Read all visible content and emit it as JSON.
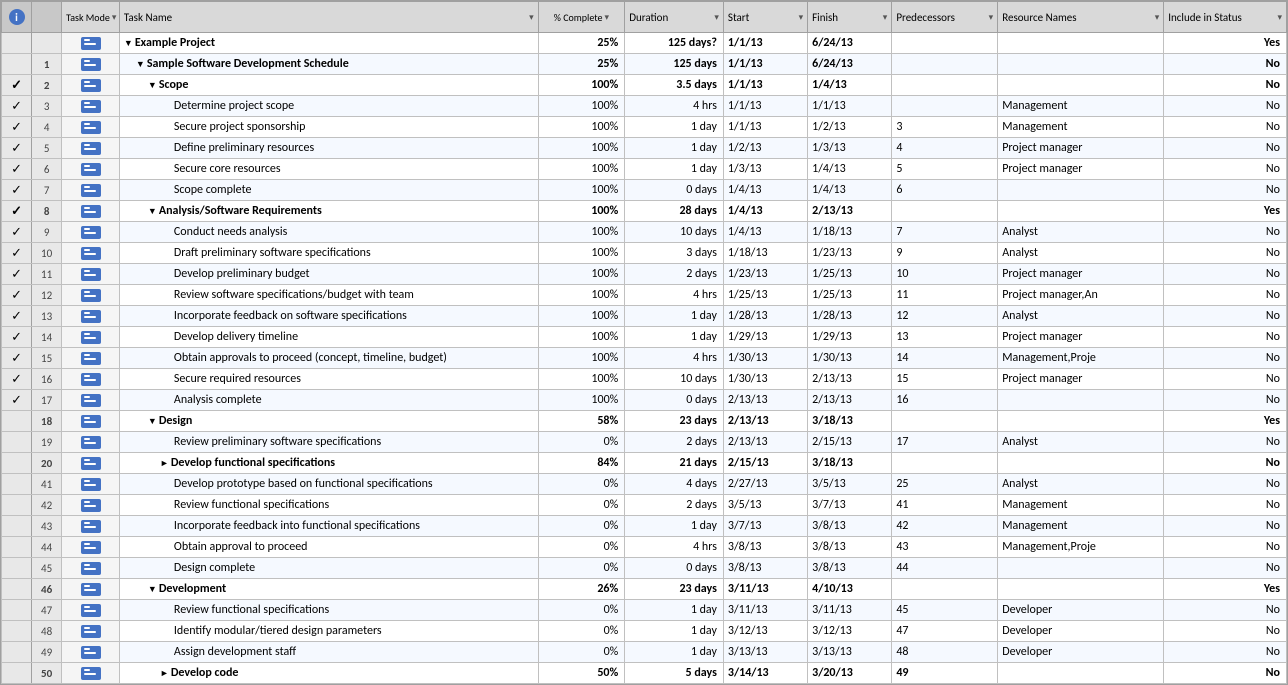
{
  "header": {
    "col_info": "i",
    "col_mode": "Task\nMode",
    "col_name": "Task Name",
    "col_pct": "% Complete",
    "col_duration": "Duration",
    "col_start": "Start",
    "col_finish": "Finish",
    "col_pred": "Predecessors",
    "col_resource": "Resource Names",
    "col_status": "Include in Status"
  },
  "rows": [
    {
      "row": "",
      "check": false,
      "mode": "auto",
      "indent": 0,
      "collapse": "collapse",
      "bold": true,
      "name": "Example Project",
      "pct": "25%",
      "duration": "125 days?",
      "start": "1/1/13",
      "finish": "6/24/13",
      "pred": "",
      "resource": "",
      "status": "Yes"
    },
    {
      "row": "1",
      "check": false,
      "mode": "auto",
      "indent": 1,
      "collapse": "collapse",
      "bold": true,
      "name": "Sample Software Development Schedule",
      "pct": "25%",
      "duration": "125 days",
      "start": "1/1/13",
      "finish": "6/24/13",
      "pred": "",
      "resource": "",
      "status": "No"
    },
    {
      "row": "2",
      "check": true,
      "mode": "auto",
      "indent": 2,
      "collapse": "collapse",
      "bold": true,
      "name": "Scope",
      "pct": "100%",
      "duration": "3.5 days",
      "start": "1/1/13",
      "finish": "1/4/13",
      "pred": "",
      "resource": "",
      "status": "No"
    },
    {
      "row": "3",
      "check": true,
      "mode": "auto",
      "indent": 3,
      "collapse": null,
      "bold": false,
      "name": "Determine project scope",
      "pct": "100%",
      "duration": "4 hrs",
      "start": "1/1/13",
      "finish": "1/1/13",
      "pred": "",
      "resource": "Management",
      "status": "No"
    },
    {
      "row": "4",
      "check": true,
      "mode": "auto",
      "indent": 3,
      "collapse": null,
      "bold": false,
      "name": "Secure project sponsorship",
      "pct": "100%",
      "duration": "1 day",
      "start": "1/1/13",
      "finish": "1/2/13",
      "pred": "3",
      "resource": "Management",
      "status": "No"
    },
    {
      "row": "5",
      "check": true,
      "mode": "auto",
      "indent": 3,
      "collapse": null,
      "bold": false,
      "name": "Define preliminary resources",
      "pct": "100%",
      "duration": "1 day",
      "start": "1/2/13",
      "finish": "1/3/13",
      "pred": "4",
      "resource": "Project manager",
      "status": "No"
    },
    {
      "row": "6",
      "check": true,
      "mode": "auto",
      "indent": 3,
      "collapse": null,
      "bold": false,
      "name": "Secure core resources",
      "pct": "100%",
      "duration": "1 day",
      "start": "1/3/13",
      "finish": "1/4/13",
      "pred": "5",
      "resource": "Project manager",
      "status": "No"
    },
    {
      "row": "7",
      "check": true,
      "mode": "auto",
      "indent": 3,
      "collapse": null,
      "bold": false,
      "name": "Scope complete",
      "pct": "100%",
      "duration": "0 days",
      "start": "1/4/13",
      "finish": "1/4/13",
      "pred": "6",
      "resource": "",
      "status": "No"
    },
    {
      "row": "8",
      "check": true,
      "mode": "auto",
      "indent": 2,
      "collapse": "collapse",
      "bold": true,
      "name": "Analysis/Software Requirements",
      "pct": "100%",
      "duration": "28 days",
      "start": "1/4/13",
      "finish": "2/13/13",
      "pred": "",
      "resource": "",
      "status": "Yes"
    },
    {
      "row": "9",
      "check": true,
      "mode": "auto",
      "indent": 3,
      "collapse": null,
      "bold": false,
      "name": "Conduct needs analysis",
      "pct": "100%",
      "duration": "10 days",
      "start": "1/4/13",
      "finish": "1/18/13",
      "pred": "7",
      "resource": "Analyst",
      "status": "No"
    },
    {
      "row": "10",
      "check": true,
      "mode": "auto",
      "indent": 3,
      "collapse": null,
      "bold": false,
      "name": "Draft preliminary software specifications",
      "pct": "100%",
      "duration": "3 days",
      "start": "1/18/13",
      "finish": "1/23/13",
      "pred": "9",
      "resource": "Analyst",
      "status": "No"
    },
    {
      "row": "11",
      "check": true,
      "mode": "auto",
      "indent": 3,
      "collapse": null,
      "bold": false,
      "name": "Develop preliminary budget",
      "pct": "100%",
      "duration": "2 days",
      "start": "1/23/13",
      "finish": "1/25/13",
      "pred": "10",
      "resource": "Project manager",
      "status": "No"
    },
    {
      "row": "12",
      "check": true,
      "mode": "auto",
      "indent": 3,
      "collapse": null,
      "bold": false,
      "name": "Review software specifications/budget with team",
      "pct": "100%",
      "duration": "4 hrs",
      "start": "1/25/13",
      "finish": "1/25/13",
      "pred": "11",
      "resource": "Project manager,An",
      "status": "No"
    },
    {
      "row": "13",
      "check": true,
      "mode": "auto",
      "indent": 3,
      "collapse": null,
      "bold": false,
      "name": "Incorporate feedback on software specifications",
      "pct": "100%",
      "duration": "1 day",
      "start": "1/28/13",
      "finish": "1/28/13",
      "pred": "12",
      "resource": "Analyst",
      "status": "No"
    },
    {
      "row": "14",
      "check": true,
      "mode": "auto",
      "indent": 3,
      "collapse": null,
      "bold": false,
      "name": "Develop delivery timeline",
      "pct": "100%",
      "duration": "1 day",
      "start": "1/29/13",
      "finish": "1/29/13",
      "pred": "13",
      "resource": "Project manager",
      "status": "No"
    },
    {
      "row": "15",
      "check": true,
      "mode": "auto",
      "indent": 3,
      "collapse": null,
      "bold": false,
      "name": "Obtain approvals to proceed (concept, timeline, budget)",
      "pct": "100%",
      "duration": "4 hrs",
      "start": "1/30/13",
      "finish": "1/30/13",
      "pred": "14",
      "resource": "Management,Proje",
      "status": "No"
    },
    {
      "row": "16",
      "check": true,
      "mode": "auto",
      "indent": 3,
      "collapse": null,
      "bold": false,
      "name": "Secure required resources",
      "pct": "100%",
      "duration": "10 days",
      "start": "1/30/13",
      "finish": "2/13/13",
      "pred": "15",
      "resource": "Project manager",
      "status": "No"
    },
    {
      "row": "17",
      "check": true,
      "mode": "auto",
      "indent": 3,
      "collapse": null,
      "bold": false,
      "name": "Analysis complete",
      "pct": "100%",
      "duration": "0 days",
      "start": "2/13/13",
      "finish": "2/13/13",
      "pred": "16",
      "resource": "",
      "status": "No"
    },
    {
      "row": "18",
      "check": false,
      "mode": "auto",
      "indent": 2,
      "collapse": "collapse",
      "bold": true,
      "name": "Design",
      "pct": "58%",
      "duration": "23 days",
      "start": "2/13/13",
      "finish": "3/18/13",
      "pred": "",
      "resource": "",
      "status": "Yes"
    },
    {
      "row": "19",
      "check": false,
      "mode": "auto",
      "indent": 3,
      "collapse": null,
      "bold": false,
      "name": "Review preliminary software specifications",
      "pct": "0%",
      "duration": "2 days",
      "start": "2/13/13",
      "finish": "2/15/13",
      "pred": "17",
      "resource": "Analyst",
      "status": "No"
    },
    {
      "row": "20",
      "check": false,
      "mode": "auto",
      "indent": 3,
      "collapse": "expand",
      "bold": true,
      "name": "Develop functional specifications",
      "pct": "84%",
      "duration": "21 days",
      "start": "2/15/13",
      "finish": "3/18/13",
      "pred": "",
      "resource": "",
      "status": "No"
    },
    {
      "row": "41",
      "check": false,
      "mode": "auto",
      "indent": 3,
      "collapse": null,
      "bold": false,
      "name": "Develop prototype based on functional specifications",
      "pct": "0%",
      "duration": "4 days",
      "start": "2/27/13",
      "finish": "3/5/13",
      "pred": "25",
      "resource": "Analyst",
      "status": "No"
    },
    {
      "row": "42",
      "check": false,
      "mode": "auto",
      "indent": 3,
      "collapse": null,
      "bold": false,
      "name": "Review functional specifications",
      "pct": "0%",
      "duration": "2 days",
      "start": "3/5/13",
      "finish": "3/7/13",
      "pred": "41",
      "resource": "Management",
      "status": "No"
    },
    {
      "row": "43",
      "check": false,
      "mode": "auto",
      "indent": 3,
      "collapse": null,
      "bold": false,
      "name": "Incorporate feedback into functional specifications",
      "pct": "0%",
      "duration": "1 day",
      "start": "3/7/13",
      "finish": "3/8/13",
      "pred": "42",
      "resource": "Management",
      "status": "No"
    },
    {
      "row": "44",
      "check": false,
      "mode": "auto",
      "indent": 3,
      "collapse": null,
      "bold": false,
      "name": "Obtain approval to proceed",
      "pct": "0%",
      "duration": "4 hrs",
      "start": "3/8/13",
      "finish": "3/8/13",
      "pred": "43",
      "resource": "Management,Proje",
      "status": "No"
    },
    {
      "row": "45",
      "check": false,
      "mode": "auto",
      "indent": 3,
      "collapse": null,
      "bold": false,
      "name": "Design complete",
      "pct": "0%",
      "duration": "0 days",
      "start": "3/8/13",
      "finish": "3/8/13",
      "pred": "44",
      "resource": "",
      "status": "No"
    },
    {
      "row": "46",
      "check": false,
      "mode": "auto",
      "indent": 2,
      "collapse": "collapse",
      "bold": true,
      "name": "Development",
      "pct": "26%",
      "duration": "23 days",
      "start": "3/11/13",
      "finish": "4/10/13",
      "pred": "",
      "resource": "",
      "status": "Yes"
    },
    {
      "row": "47",
      "check": false,
      "mode": "auto",
      "indent": 3,
      "collapse": null,
      "bold": false,
      "name": "Review functional specifications",
      "pct": "0%",
      "duration": "1 day",
      "start": "3/11/13",
      "finish": "3/11/13",
      "pred": "45",
      "resource": "Developer",
      "status": "No"
    },
    {
      "row": "48",
      "check": false,
      "mode": "auto",
      "indent": 3,
      "collapse": null,
      "bold": false,
      "name": "Identify modular/tiered design parameters",
      "pct": "0%",
      "duration": "1 day",
      "start": "3/12/13",
      "finish": "3/12/13",
      "pred": "47",
      "resource": "Developer",
      "status": "No"
    },
    {
      "row": "49",
      "check": false,
      "mode": "auto",
      "indent": 3,
      "collapse": null,
      "bold": false,
      "name": "Assign development staff",
      "pct": "0%",
      "duration": "1 day",
      "start": "3/13/13",
      "finish": "3/13/13",
      "pred": "48",
      "resource": "Developer",
      "status": "No"
    },
    {
      "row": "50",
      "check": false,
      "mode": "auto",
      "indent": 3,
      "collapse": "expand",
      "bold": true,
      "name": "Develop code",
      "pct": "50%",
      "duration": "5 days",
      "start": "3/14/13",
      "finish": "3/20/13",
      "pred": "49",
      "resource": "",
      "status": "No"
    }
  ]
}
